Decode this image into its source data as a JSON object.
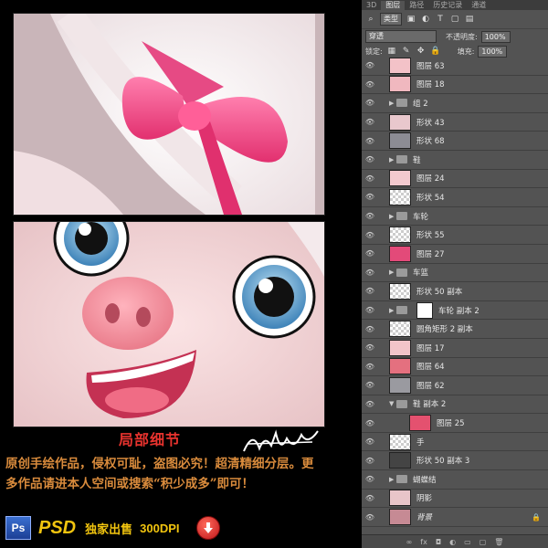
{
  "artwork": {
    "caption_title": "局部细节",
    "description": "原创手绘作品，侵权可耻，盗图必究！超清精细分层。更多作品请进本人空间或搜索“积少成多”即可！",
    "ps_label": "Ps",
    "psd_label": "PSD",
    "exclusive_label": "独家出售",
    "dpi_label": "300DPI"
  },
  "panel": {
    "tabs": [
      "3D",
      "图层",
      "路径",
      "历史记录",
      "通道"
    ],
    "filter_kind": "类型",
    "blend_mode": "穿透",
    "opacity_label": "不透明度:",
    "opacity_value": "100%",
    "lock_label": "锁定:",
    "fill_label": "填充:",
    "fill_value": "100%",
    "layers": [
      {
        "name": "图层 63",
        "kind": "layer",
        "thumb": "#f3c2c8"
      },
      {
        "name": "图层 18",
        "kind": "layer",
        "thumb": "#f0b8bf"
      },
      {
        "name": "组 2",
        "kind": "group"
      },
      {
        "name": "形状 43",
        "kind": "layer",
        "thumb": "#e9c8cd"
      },
      {
        "name": "形状 68",
        "kind": "layer",
        "thumb": "#8c8c94"
      },
      {
        "name": "鞋",
        "kind": "group"
      },
      {
        "name": "图层 24",
        "kind": "layer",
        "thumb": "#f3c9ce"
      },
      {
        "name": "形状 54",
        "kind": "layer",
        "thumb": ""
      },
      {
        "name": "车轮",
        "kind": "group"
      },
      {
        "name": "形状 55",
        "kind": "layer",
        "thumb": ""
      },
      {
        "name": "图层 27",
        "kind": "layer",
        "thumb": "#e34a79"
      },
      {
        "name": "车篮",
        "kind": "group"
      },
      {
        "name": "形状 50 副本",
        "kind": "layer",
        "thumb": ""
      },
      {
        "name": "车轮 副本 2",
        "kind": "group-mask"
      },
      {
        "name": "圆角矩形 2 副本",
        "kind": "layer",
        "thumb": ""
      },
      {
        "name": "图层 17",
        "kind": "layer",
        "thumb": "#f2c4c9"
      },
      {
        "name": "图层 64",
        "kind": "layer",
        "thumb": "#e4707f"
      },
      {
        "name": "图层 62",
        "kind": "layer",
        "thumb": "#9a9aa0"
      },
      {
        "name": "鞋 副本 2",
        "kind": "group-open"
      },
      {
        "name": "图层 25",
        "kind": "sublayer",
        "thumb": "#e4516f"
      },
      {
        "name": "手",
        "kind": "layer",
        "thumb": ""
      },
      {
        "name": "形状 50 副本 3",
        "kind": "layer",
        "thumb": "#444"
      },
      {
        "name": "蝴蝶结",
        "kind": "group"
      },
      {
        "name": "阴影",
        "kind": "layer",
        "thumb": "#e8c5c9"
      },
      {
        "name": "背景",
        "kind": "background",
        "thumb": "#c68a94"
      }
    ],
    "footer_icons": [
      "link-icon",
      "fx-icon",
      "mask-icon",
      "adjustment-icon",
      "folder-icon",
      "new-layer-icon",
      "trash-icon"
    ]
  }
}
